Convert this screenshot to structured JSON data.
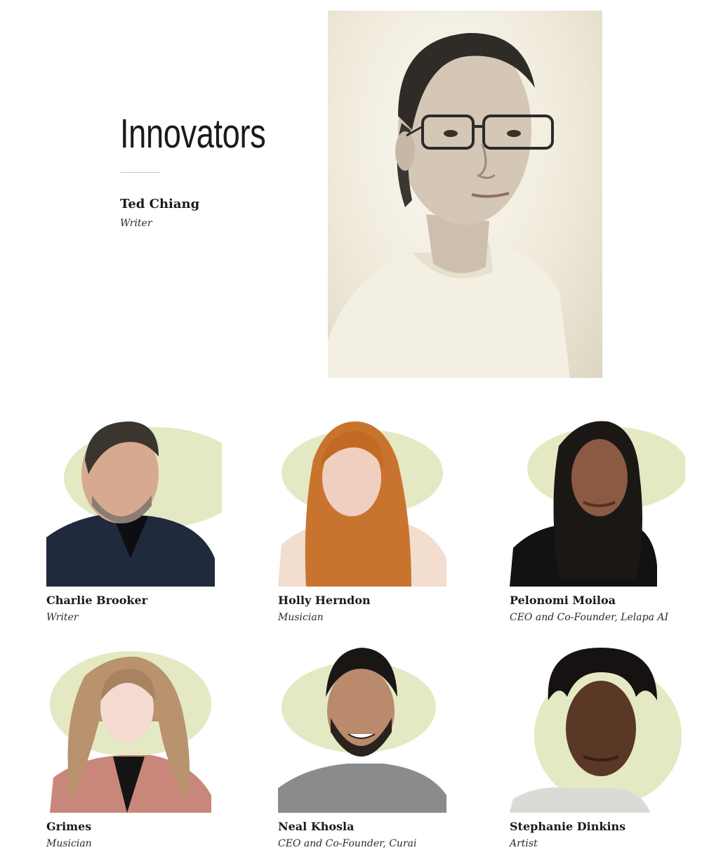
{
  "section": {
    "title": "Innovators"
  },
  "featured": {
    "name": "Ted Chiang",
    "role": "Writer"
  },
  "people": [
    {
      "name": "Charlie Brooker",
      "role": "Writer"
    },
    {
      "name": "Holly Herndon",
      "role": "Musician"
    },
    {
      "name": "Pelonomi Moiloa",
      "role": "CEO and Co-Founder, Lelapa AI"
    },
    {
      "name": "Grimes",
      "role": "Musician"
    },
    {
      "name": "Neal Khosla",
      "role": "CEO and Co-Founder, Curai"
    },
    {
      "name": "Stephanie Dinkins",
      "role": "Artist"
    }
  ],
  "colors": {
    "text": "#1a1a1a",
    "rule": "#c9c9c9",
    "watercolor_blob": "#dfe5b8"
  }
}
